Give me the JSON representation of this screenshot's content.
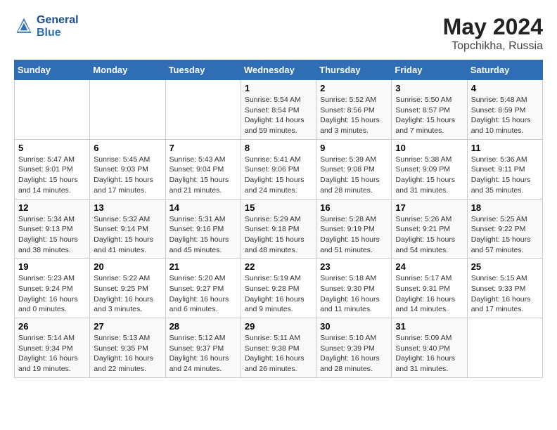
{
  "header": {
    "logo_line1": "General",
    "logo_line2": "Blue",
    "main_title": "May 2024",
    "sub_title": "Topchikha, Russia"
  },
  "weekdays": [
    "Sunday",
    "Monday",
    "Tuesday",
    "Wednesday",
    "Thursday",
    "Friday",
    "Saturday"
  ],
  "weeks": [
    [
      {
        "day": "",
        "info": ""
      },
      {
        "day": "",
        "info": ""
      },
      {
        "day": "",
        "info": ""
      },
      {
        "day": "1",
        "info": "Sunrise: 5:54 AM\nSunset: 8:54 PM\nDaylight: 14 hours\nand 59 minutes."
      },
      {
        "day": "2",
        "info": "Sunrise: 5:52 AM\nSunset: 8:56 PM\nDaylight: 15 hours\nand 3 minutes."
      },
      {
        "day": "3",
        "info": "Sunrise: 5:50 AM\nSunset: 8:57 PM\nDaylight: 15 hours\nand 7 minutes."
      },
      {
        "day": "4",
        "info": "Sunrise: 5:48 AM\nSunset: 8:59 PM\nDaylight: 15 hours\nand 10 minutes."
      }
    ],
    [
      {
        "day": "5",
        "info": "Sunrise: 5:47 AM\nSunset: 9:01 PM\nDaylight: 15 hours\nand 14 minutes."
      },
      {
        "day": "6",
        "info": "Sunrise: 5:45 AM\nSunset: 9:03 PM\nDaylight: 15 hours\nand 17 minutes."
      },
      {
        "day": "7",
        "info": "Sunrise: 5:43 AM\nSunset: 9:04 PM\nDaylight: 15 hours\nand 21 minutes."
      },
      {
        "day": "8",
        "info": "Sunrise: 5:41 AM\nSunset: 9:06 PM\nDaylight: 15 hours\nand 24 minutes."
      },
      {
        "day": "9",
        "info": "Sunrise: 5:39 AM\nSunset: 9:08 PM\nDaylight: 15 hours\nand 28 minutes."
      },
      {
        "day": "10",
        "info": "Sunrise: 5:38 AM\nSunset: 9:09 PM\nDaylight: 15 hours\nand 31 minutes."
      },
      {
        "day": "11",
        "info": "Sunrise: 5:36 AM\nSunset: 9:11 PM\nDaylight: 15 hours\nand 35 minutes."
      }
    ],
    [
      {
        "day": "12",
        "info": "Sunrise: 5:34 AM\nSunset: 9:13 PM\nDaylight: 15 hours\nand 38 minutes."
      },
      {
        "day": "13",
        "info": "Sunrise: 5:32 AM\nSunset: 9:14 PM\nDaylight: 15 hours\nand 41 minutes."
      },
      {
        "day": "14",
        "info": "Sunrise: 5:31 AM\nSunset: 9:16 PM\nDaylight: 15 hours\nand 45 minutes."
      },
      {
        "day": "15",
        "info": "Sunrise: 5:29 AM\nSunset: 9:18 PM\nDaylight: 15 hours\nand 48 minutes."
      },
      {
        "day": "16",
        "info": "Sunrise: 5:28 AM\nSunset: 9:19 PM\nDaylight: 15 hours\nand 51 minutes."
      },
      {
        "day": "17",
        "info": "Sunrise: 5:26 AM\nSunset: 9:21 PM\nDaylight: 15 hours\nand 54 minutes."
      },
      {
        "day": "18",
        "info": "Sunrise: 5:25 AM\nSunset: 9:22 PM\nDaylight: 15 hours\nand 57 minutes."
      }
    ],
    [
      {
        "day": "19",
        "info": "Sunrise: 5:23 AM\nSunset: 9:24 PM\nDaylight: 16 hours\nand 0 minutes."
      },
      {
        "day": "20",
        "info": "Sunrise: 5:22 AM\nSunset: 9:25 PM\nDaylight: 16 hours\nand 3 minutes."
      },
      {
        "day": "21",
        "info": "Sunrise: 5:20 AM\nSunset: 9:27 PM\nDaylight: 16 hours\nand 6 minutes."
      },
      {
        "day": "22",
        "info": "Sunrise: 5:19 AM\nSunset: 9:28 PM\nDaylight: 16 hours\nand 9 minutes."
      },
      {
        "day": "23",
        "info": "Sunrise: 5:18 AM\nSunset: 9:30 PM\nDaylight: 16 hours\nand 11 minutes."
      },
      {
        "day": "24",
        "info": "Sunrise: 5:17 AM\nSunset: 9:31 PM\nDaylight: 16 hours\nand 14 minutes."
      },
      {
        "day": "25",
        "info": "Sunrise: 5:15 AM\nSunset: 9:33 PM\nDaylight: 16 hours\nand 17 minutes."
      }
    ],
    [
      {
        "day": "26",
        "info": "Sunrise: 5:14 AM\nSunset: 9:34 PM\nDaylight: 16 hours\nand 19 minutes."
      },
      {
        "day": "27",
        "info": "Sunrise: 5:13 AM\nSunset: 9:35 PM\nDaylight: 16 hours\nand 22 minutes."
      },
      {
        "day": "28",
        "info": "Sunrise: 5:12 AM\nSunset: 9:37 PM\nDaylight: 16 hours\nand 24 minutes."
      },
      {
        "day": "29",
        "info": "Sunrise: 5:11 AM\nSunset: 9:38 PM\nDaylight: 16 hours\nand 26 minutes."
      },
      {
        "day": "30",
        "info": "Sunrise: 5:10 AM\nSunset: 9:39 PM\nDaylight: 16 hours\nand 28 minutes."
      },
      {
        "day": "31",
        "info": "Sunrise: 5:09 AM\nSunset: 9:40 PM\nDaylight: 16 hours\nand 31 minutes."
      },
      {
        "day": "",
        "info": ""
      }
    ]
  ]
}
